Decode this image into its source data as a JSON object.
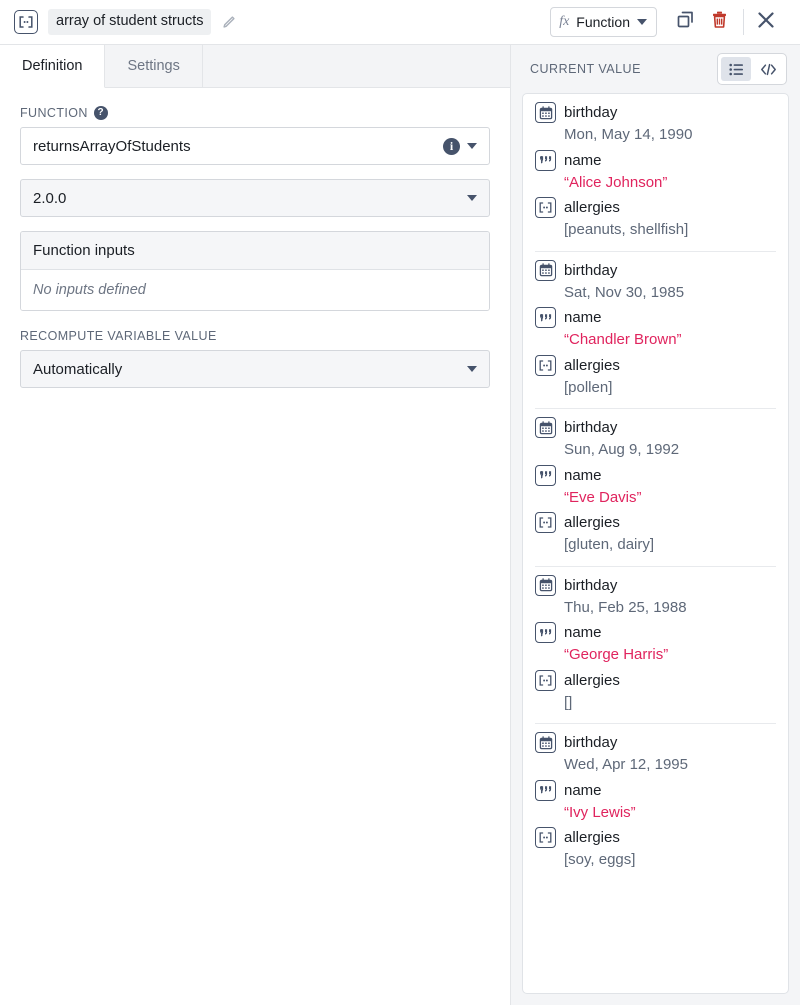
{
  "header": {
    "variable_type_icon": "array-bracket-icon",
    "variable_name": "array of student structs",
    "edit_icon": "pencil-icon",
    "function_chip": {
      "fx_symbol": "fx",
      "label": "Function",
      "caret_icon": "chevron-down-icon"
    },
    "duplicate_icon": "duplicate-icon",
    "delete_icon": "trash-icon",
    "close_icon": "close-icon"
  },
  "tabs": [
    {
      "label": "Definition",
      "active": true
    },
    {
      "label": "Settings",
      "active": false
    }
  ],
  "definition": {
    "function_label": "FUNCTION",
    "function_help_icon": "question-mark-icon",
    "function_name": "returnsArrayOfStudents",
    "function_info_icon": "info-icon",
    "function_caret_icon": "chevron-down-icon",
    "version": "2.0.0",
    "version_caret_icon": "chevron-down-icon",
    "inputs_header": "Function inputs",
    "inputs_empty_text": "No inputs defined",
    "recompute_label": "RECOMPUTE VARIABLE VALUE",
    "recompute_value": "Automatically",
    "recompute_caret_icon": "chevron-down-icon"
  },
  "current_value": {
    "title": "CURRENT VALUE",
    "view_toggle": {
      "list_view_icon": "list-view-icon",
      "code_view_icon": "code-view-icon",
      "active": "list-view-icon"
    },
    "records": [
      {
        "properties": [
          {
            "icon": "calendar-icon",
            "key": "birthday",
            "value": "Mon, May 14, 1990",
            "kind": "date"
          },
          {
            "icon": "quote-icon",
            "key": "name",
            "value": "“Alice Johnson”",
            "kind": "string"
          },
          {
            "icon": "array-bracket-icon",
            "key": "allergies",
            "value": "[peanuts, shellfish]",
            "kind": "array"
          }
        ]
      },
      {
        "properties": [
          {
            "icon": "calendar-icon",
            "key": "birthday",
            "value": "Sat, Nov 30, 1985",
            "kind": "date"
          },
          {
            "icon": "quote-icon",
            "key": "name",
            "value": "“Chandler Brown”",
            "kind": "string"
          },
          {
            "icon": "array-bracket-icon",
            "key": "allergies",
            "value": "[pollen]",
            "kind": "array"
          }
        ]
      },
      {
        "properties": [
          {
            "icon": "calendar-icon",
            "key": "birthday",
            "value": "Sun, Aug 9, 1992",
            "kind": "date"
          },
          {
            "icon": "quote-icon",
            "key": "name",
            "value": "“Eve Davis”",
            "kind": "string"
          },
          {
            "icon": "array-bracket-icon",
            "key": "allergies",
            "value": "[gluten, dairy]",
            "kind": "array"
          }
        ]
      },
      {
        "properties": [
          {
            "icon": "calendar-icon",
            "key": "birthday",
            "value": "Thu, Feb 25, 1988",
            "kind": "date"
          },
          {
            "icon": "quote-icon",
            "key": "name",
            "value": "“George Harris”",
            "kind": "string"
          },
          {
            "icon": "array-bracket-icon",
            "key": "allergies",
            "value": "[]",
            "kind": "array"
          }
        ]
      },
      {
        "properties": [
          {
            "icon": "calendar-icon",
            "key": "birthday",
            "value": "Wed, Apr 12, 1995",
            "kind": "date"
          },
          {
            "icon": "quote-icon",
            "key": "name",
            "value": "“Ivy Lewis”",
            "kind": "string"
          },
          {
            "icon": "array-bracket-icon",
            "key": "allergies",
            "value": "[soy, eggs]",
            "kind": "array"
          }
        ]
      }
    ]
  },
  "colors": {
    "string_value": "#e0245e",
    "delete_icon": "#c0392b",
    "icon_stroke": "#46536b",
    "label_text": "#5e6878",
    "panel_bg": "#f4f5f7"
  }
}
